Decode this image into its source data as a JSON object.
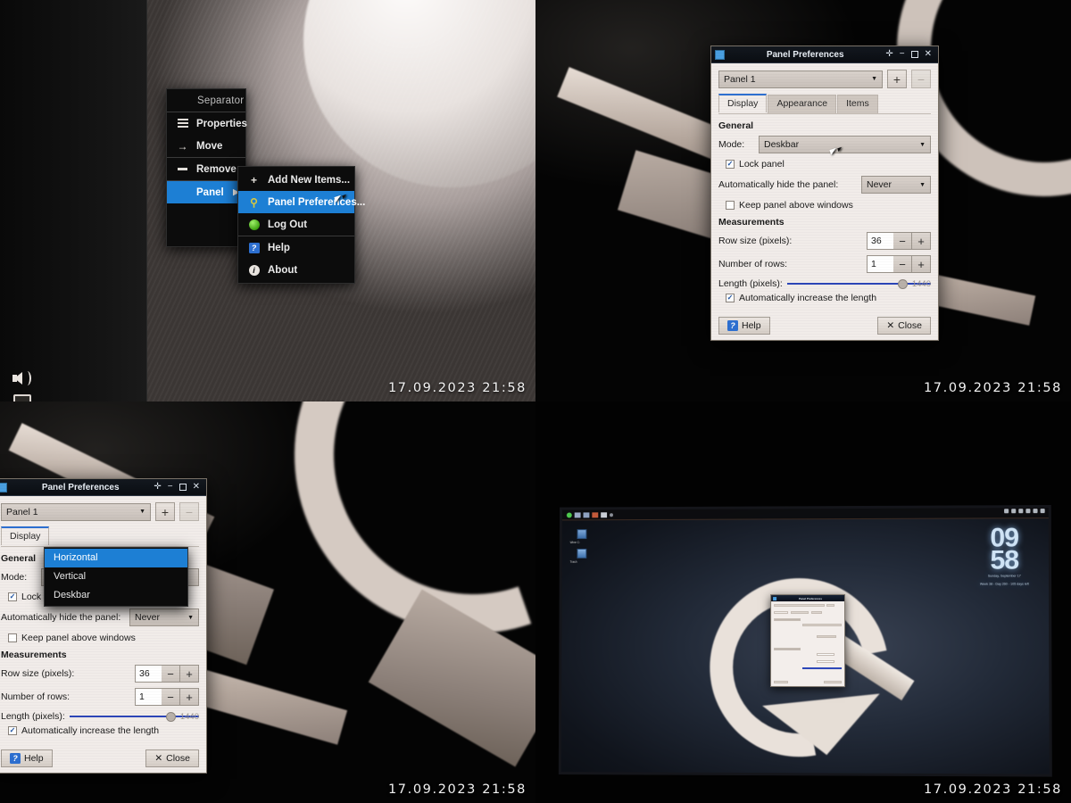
{
  "timestamp": "17.09.2023 21:58",
  "quadrants": {
    "top_left": {
      "name": "context-menu-quadrant",
      "context_menu": {
        "header": "Separator",
        "items": [
          {
            "label": "Properties",
            "icon": "list-icon",
            "selected": false
          },
          {
            "label": "Move",
            "icon": "arrow-right-icon",
            "selected": false
          },
          {
            "label": "Remove",
            "icon": "dash-icon",
            "selected": false
          },
          {
            "label": "Panel",
            "icon": "none",
            "selected": true,
            "submenu": true
          }
        ]
      },
      "submenu": {
        "items": [
          {
            "label": "Add New Items...",
            "icon": "plus-icon",
            "selected": false
          },
          {
            "label": "Panel Preferences...",
            "icon": "preferences-icon",
            "selected": true
          },
          {
            "label": "Log Out",
            "icon": "logout-icon",
            "selected": false
          },
          {
            "label": "Help",
            "icon": "help-icon",
            "selected": false
          },
          {
            "label": "About",
            "icon": "about-icon",
            "selected": false
          }
        ]
      },
      "panel_tray": [
        {
          "icon": "volume-icon"
        },
        {
          "icon": "display-icon"
        }
      ]
    },
    "top_right": {
      "name": "panel-preferences-quadrant",
      "dialog": {
        "title": "Panel Preferences",
        "titlebar_buttons": [
          "stick",
          "minimize",
          "maximize",
          "close"
        ],
        "panel_select": {
          "value": "Panel 1"
        },
        "add_button": "+",
        "remove_button": "−",
        "tabs": [
          {
            "label": "Display",
            "active": true
          },
          {
            "label": "Appearance",
            "active": false
          },
          {
            "label": "Items",
            "active": false
          }
        ],
        "general": {
          "heading": "General",
          "mode_label": "Mode:",
          "mode_value": "Deskbar",
          "lock_panel": {
            "label": "Lock panel",
            "checked": true
          },
          "autohide_label": "Automatically hide the panel:",
          "autohide_value": "Never",
          "keep_above": {
            "label": "Keep panel above windows",
            "checked": false
          }
        },
        "measurements": {
          "heading": "Measurements",
          "row_size_label": "Row size (pixels):",
          "row_size_value": "36",
          "num_rows_label": "Number of rows:",
          "num_rows_value": "1",
          "length_label": "Length (pixels):",
          "length_value": "1440",
          "auto_increase": {
            "label": "Automatically increase the length",
            "checked": true
          }
        },
        "buttons": {
          "help": "Help",
          "close": "Close"
        }
      }
    },
    "bottom_left": {
      "name": "mode-dropdown-open-quadrant",
      "dialog": {
        "title": "Panel Preferences",
        "panel_select": {
          "value": "Panel 1"
        },
        "tabs": [
          {
            "label": "Display",
            "active": true
          }
        ],
        "general": {
          "heading": "General",
          "mode_label": "Mode:",
          "mode_value": "Deskbar",
          "lock_panel": {
            "label": "Lock panel",
            "checked": true
          },
          "autohide_label": "Automatically hide the panel:",
          "autohide_value": "Never",
          "keep_above": {
            "label": "Keep panel above windows",
            "checked": false
          }
        },
        "measurements": {
          "heading": "Measurements",
          "row_size_label": "Row size (pixels):",
          "row_size_value": "36",
          "num_rows_label": "Number of rows:",
          "num_rows_value": "1",
          "length_label": "Length (pixels):",
          "length_value": "1440",
          "auto_increase": {
            "label": "Automatically increase the length",
            "checked": true
          }
        },
        "buttons": {
          "help": "Help",
          "close": "Close"
        },
        "mode_dropdown": {
          "open": true,
          "options": [
            {
              "label": "Horizontal",
              "selected": true
            },
            {
              "label": "Vertical",
              "selected": false
            },
            {
              "label": "Deskbar",
              "selected": false
            }
          ]
        }
      }
    },
    "bottom_right": {
      "name": "monitor-overview-quadrant",
      "desktop": {
        "clock": {
          "hours": "09",
          "minutes": "58",
          "sub_line_1": "Sunday, September 17",
          "sub_line_2": "Week 38 - Day 260 - 105 days left"
        },
        "desktop_icons": [
          {
            "label": "Wine C:"
          },
          {
            "label": "Trash"
          }
        ],
        "mini_dialog_title": "Panel Preferences"
      }
    }
  }
}
